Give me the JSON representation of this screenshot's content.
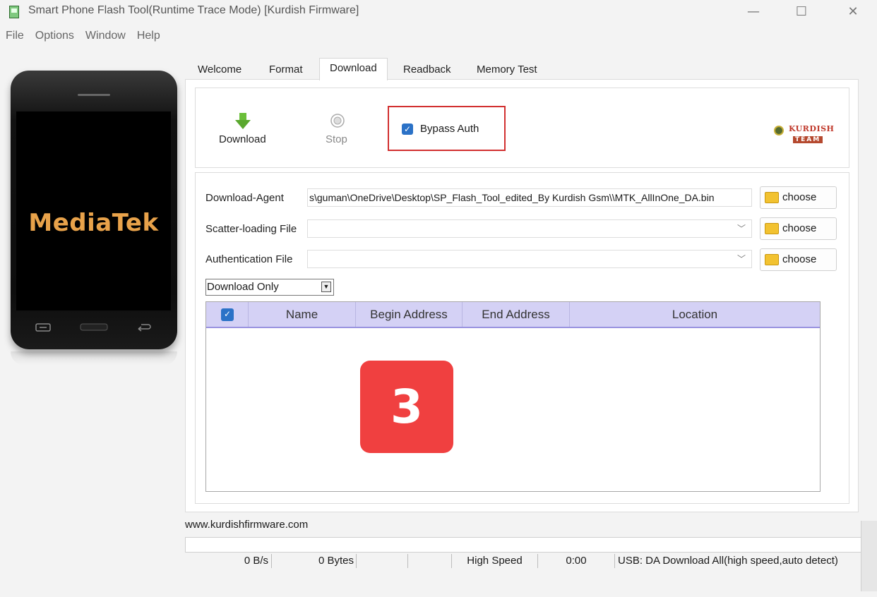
{
  "window": {
    "title": "Smart Phone Flash Tool(Runtime Trace Mode) [Kurdish Firmware]",
    "minimize_glyph": "—",
    "maximize_glyph": "☐",
    "close_glyph": "✕"
  },
  "menu": [
    "File",
    "Options",
    "Window",
    "Help"
  ],
  "phone": {
    "brand": "MediaTek"
  },
  "tabs": [
    {
      "label": "Welcome",
      "active": false
    },
    {
      "label": "Format",
      "active": false
    },
    {
      "label": "Download",
      "active": true
    },
    {
      "label": "Readback",
      "active": false
    },
    {
      "label": "Memory Test",
      "active": false
    }
  ],
  "toolbar": {
    "download_label": "Download",
    "stop_label": "Stop",
    "bypass_auth_label": "Bypass Auth",
    "bypass_auth_checked": true
  },
  "logo": {
    "top": "KURDISH",
    "bottom": "TEAM"
  },
  "fields": {
    "download_agent": {
      "label": "Download-Agent",
      "value": "s\\guman\\OneDrive\\Desktop\\SP_Flash_Tool_edited_By Kurdish Gsm\\\\MTK_AllInOne_DA.bin",
      "button": "choose"
    },
    "scatter": {
      "label": "Scatter-loading File",
      "value": "",
      "button": "choose"
    },
    "auth": {
      "label": "Authentication File",
      "value": "",
      "button": "choose"
    }
  },
  "mode": {
    "selected": "Download Only"
  },
  "table": {
    "columns": [
      "Name",
      "Begin Address",
      "End Address",
      "Location"
    ],
    "header_checked": true,
    "rows": []
  },
  "badge": "3",
  "footer": {
    "website": "www.kurdishfirmware.com",
    "status": {
      "speed": "0 B/s",
      "bytes": "0 Bytes",
      "mode": "High Speed",
      "time": "0:00",
      "usb": "USB: DA Download All(high speed,auto detect)"
    }
  },
  "colors": {
    "accent_blue": "#2b72c7",
    "highlight_red": "#d23030",
    "badge_red": "#f04040",
    "table_header": "#d4d1f5",
    "brand_orange": "#e8a24a"
  }
}
